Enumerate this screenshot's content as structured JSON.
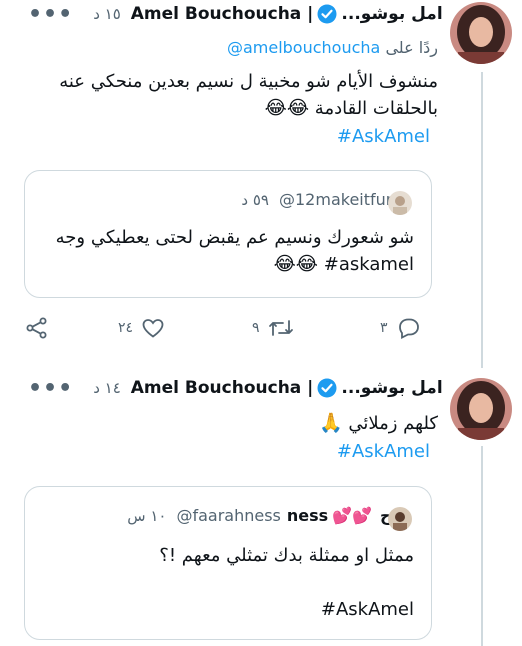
{
  "colors": {
    "accent": "#1d9bf0",
    "muted": "#536471",
    "border": "#cfd9de",
    "text": "#0f1419"
  },
  "tweets": [
    {
      "author_latin": "Amel Bouchoucha |",
      "author_arabic": "امل بوشو...",
      "time": "١٥ د",
      "replying_prefix": "ردًا على",
      "replying_to": "@amelbouchoucha",
      "text_line1": "منشوف الأيام شو مخبية ل نسيم بعدين منحكي عنه",
      "text_line2": "بالحلقات القادمة",
      "text_emoji": "😂😂",
      "hashtag": "#AskAmel",
      "quote": {
        "name": ".",
        "handle": "@12makeitfun",
        "time": "٥٩ د",
        "text_line1": "شو شعورك ونسيم عم يقبض لحتى يعطيكي وجه",
        "text_line2_emoji": "😂😂",
        "hashtag": "#askamel"
      },
      "actions": {
        "replies": "٣",
        "retweets": "٩",
        "likes": "٢٤"
      }
    },
    {
      "author_latin": "Amel Bouchoucha |",
      "author_arabic": "امل بوشو...",
      "time": "١٤ د",
      "text": "كلهم زملائي",
      "text_emoji": "🙏",
      "hashtag": "#AskAmel",
      "quote": {
        "name_arabic": "فرح",
        "name_latin": "ness",
        "hearts": "💕💕",
        "handle": "@faarahness",
        "time": "١٠ س",
        "text_line1": "ممثل او ممثلة بدك تمثلي معهم !؟",
        "hashtag": "#AskAmel"
      }
    }
  ],
  "icons": [
    "more-icon",
    "verified-icon",
    "reply-icon",
    "retweet-icon",
    "like-icon",
    "share-icon"
  ]
}
